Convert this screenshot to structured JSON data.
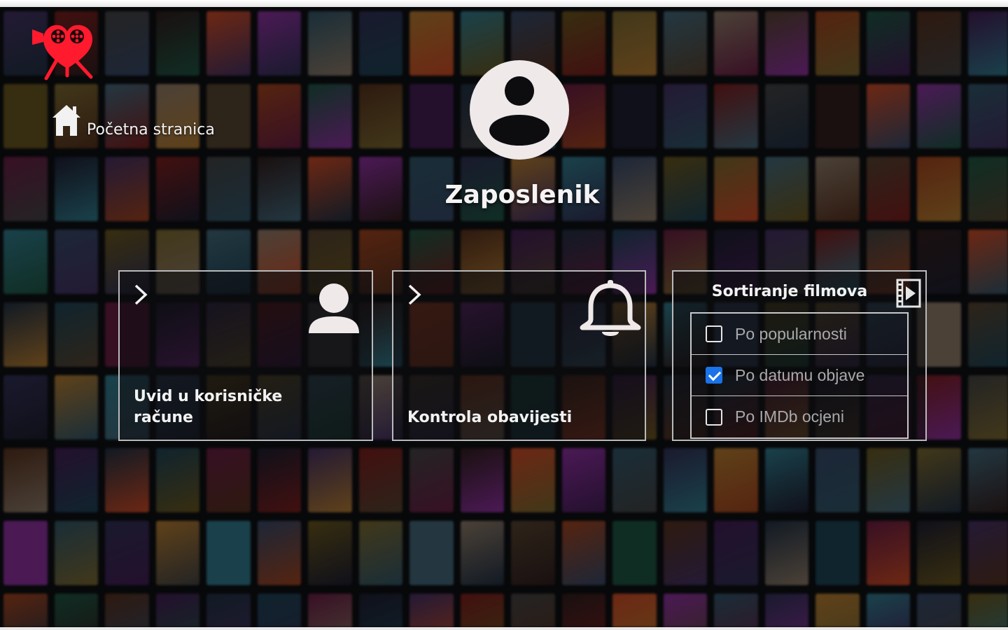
{
  "nav": {
    "home_label": "Početna stranica"
  },
  "profile": {
    "role": "Zaposlenik"
  },
  "cards": {
    "users": {
      "title": "Uvid u korisničke račune"
    },
    "notifications": {
      "title": "Kontrola obavijesti"
    }
  },
  "sort": {
    "title": "Sortiranje filmova",
    "options": [
      {
        "label": "Po popularnosti",
        "checked": false
      },
      {
        "label": "Po datumu objave",
        "checked": true
      },
      {
        "label": "Po IMDb ocjeni",
        "checked": false
      }
    ]
  },
  "colors": {
    "logo_red": "#ff1a2e",
    "accent_blue": "#1a73e8",
    "avatar_fill": "#efe9ea"
  },
  "icons": [
    "cinema-logo-icon",
    "home-icon",
    "profile-avatar-icon",
    "chevron-right-icon",
    "user-icon",
    "bell-icon",
    "film-icon"
  ]
}
